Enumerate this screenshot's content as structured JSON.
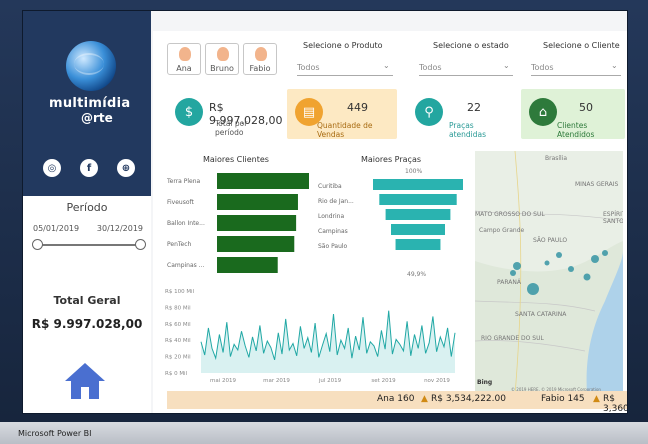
{
  "social": {
    "instagram": "◎",
    "facebook": "f",
    "web": "⊕"
  },
  "brand": {
    "name_line1": "multimídia",
    "name_line2": "@rte"
  },
  "sidebar": {
    "periodo_label": "Período",
    "date_start": "05/01/2019",
    "date_end": "30/12/2019",
    "total_label": "Total Geral",
    "total_value": "R$ 9.997.028,00"
  },
  "employees": [
    {
      "name": "Ana"
    },
    {
      "name": "Bruno"
    },
    {
      "name": "Fabio"
    }
  ],
  "filters": [
    {
      "label": "Selecione o Produto",
      "value": "Todos"
    },
    {
      "label": "Selecione o estado",
      "value": "Todos"
    },
    {
      "label": "Selecione o Cliente",
      "value": "Todos"
    }
  ],
  "cards": [
    {
      "value": "R$ 9.997.028,00",
      "label": "Total por período",
      "icon": "money-icon",
      "color": "#23a6a0",
      "bg": "#ffffff"
    },
    {
      "value": "449",
      "label": "Quantidade de Vendas",
      "icon": "cart-icon",
      "color": "#f0a330",
      "bg": "#fde9c3"
    },
    {
      "value": "22",
      "label": "Praças atendidas",
      "icon": "map-pin-icon",
      "color": "#23a6a0",
      "bg": "#ffffff"
    },
    {
      "value": "50",
      "label": "Clientes Atendidos",
      "icon": "people-icon",
      "color": "#2e7a3b",
      "bg": "#dff2d7"
    }
  ],
  "chart_clientes": {
    "title": "Maiores Clientes",
    "categories": [
      "Terra Plena",
      "Fiveusoft",
      "Ballon Inte...",
      "PenTech",
      "Campinas ..."
    ],
    "values": [
      100,
      88,
      86,
      84,
      66
    ],
    "color": "#1a6a1e"
  },
  "chart_pracas": {
    "title": "Maiores Praças",
    "top_label": "100%",
    "bottom_label": "49,9%",
    "categories": [
      "Curitiba",
      "Rio de Jan...",
      "Londrina",
      "Campinas",
      "São Paulo"
    ],
    "values": [
      100,
      86,
      72,
      60,
      49.9
    ],
    "color": "#2ab3b0"
  },
  "chart_linha": {
    "type": "area",
    "ylabels": [
      "R$ 100 Mil",
      "R$ 80 Mil",
      "R$ 60 Mil",
      "R$ 40 Mil",
      "R$ 20 Mil",
      "R$ 0 Mil"
    ],
    "xlabels": [
      "mai 2019",
      "mar 2019",
      "jul 2019",
      "set 2019",
      "nov 2019"
    ],
    "values": [
      38,
      22,
      55,
      30,
      18,
      47,
      25,
      62,
      20,
      35,
      28,
      51,
      33,
      19,
      44,
      27,
      58,
      24,
      39,
      31,
      16,
      49,
      23,
      66,
      28,
      36,
      21,
      57,
      30,
      43,
      25,
      61,
      19,
      34,
      48,
      26,
      72,
      22,
      40,
      30,
      55,
      18,
      45,
      28,
      68,
      24,
      38,
      33,
      20,
      52,
      29,
      76,
      23,
      41,
      35,
      27,
      63,
      21,
      47,
      30,
      58,
      24,
      37,
      69,
      26,
      44,
      32,
      55,
      20,
      49
    ]
  },
  "map": {
    "labels": [
      "Brasília",
      "MINAS GERAIS",
      "ESPÍRITO SANTO",
      "MATO GROSSO DO SUL",
      "Campo Grande",
      "SÃO PAULO",
      "PARANÁ",
      "SANTA CATARINA",
      "RIO GRANDE DO SUL",
      "Bing",
      "© 2019 HERE, © 2019 Microsoft Corporation"
    ]
  },
  "footer": {
    "left": "Ana 160",
    "left_amount": "R$ 3,534,222.00",
    "right": "Fabio 145",
    "right_amount": "R$ 3,360"
  },
  "taskbar": {
    "app": "Microsoft Power BI"
  }
}
